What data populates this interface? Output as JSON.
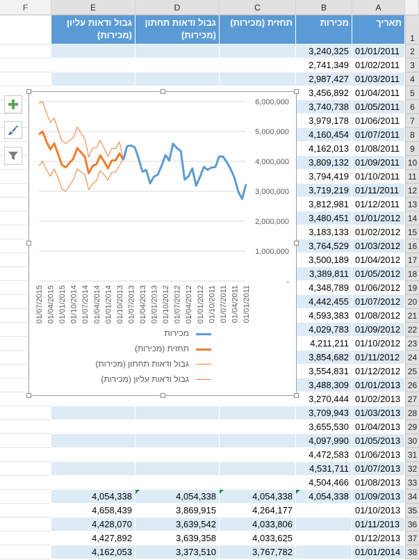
{
  "columns": [
    "F",
    "E",
    "D",
    "C",
    "B",
    "A"
  ],
  "header_row": {
    "A": "תאריך",
    "B": "מכירות",
    "C": "תחזית (מכירות)",
    "D": "גבול ודאות תחתון (מכירות)",
    "E": "גבול ודאות עליון (מכירות)"
  },
  "rows": [
    {
      "n": "1"
    },
    {
      "n": "2",
      "a": "01/01/2011",
      "b": "3,240,325"
    },
    {
      "n": "3",
      "a": "01/02/2011",
      "b": "2,741,349"
    },
    {
      "n": "4",
      "a": "01/03/2011",
      "b": "2,987,427"
    },
    {
      "n": "5",
      "a": "01/04/2011",
      "b": "3,456,892"
    },
    {
      "n": "6",
      "a": "01/05/2011",
      "b": "3,740,738"
    },
    {
      "n": "7",
      "a": "01/06/2011",
      "b": "3,979,178"
    },
    {
      "n": "8",
      "a": "01/07/2011",
      "b": "4,160,454"
    },
    {
      "n": "9",
      "a": "01/08/2011",
      "b": "4,162,013"
    },
    {
      "n": "10",
      "a": "01/09/2011",
      "b": "3,809,132"
    },
    {
      "n": "11",
      "a": "01/10/2011",
      "b": "3,794,419"
    },
    {
      "n": "12",
      "a": "01/11/2011",
      "b": "3,719,219"
    },
    {
      "n": "13",
      "a": "01/12/2011",
      "b": "3,812,981"
    },
    {
      "n": "14",
      "a": "01/01/2012",
      "b": "3,480,451"
    },
    {
      "n": "15",
      "a": "01/02/2012",
      "b": "3,183,133"
    },
    {
      "n": "16",
      "a": "01/03/2012",
      "b": "3,764,529"
    },
    {
      "n": "17",
      "a": "01/04/2012",
      "b": "3,500,189"
    },
    {
      "n": "18",
      "a": "01/05/2012",
      "b": "3,389,811"
    },
    {
      "n": "19",
      "a": "01/06/2012",
      "b": "4,348,789"
    },
    {
      "n": "20",
      "a": "01/07/2012",
      "b": "4,442,455"
    },
    {
      "n": "21",
      "a": "01/08/2012",
      "b": "4,593,383"
    },
    {
      "n": "22",
      "a": "01/09/2012",
      "b": "4,029,783"
    },
    {
      "n": "23",
      "a": "01/10/2012",
      "b": "4,211,211"
    },
    {
      "n": "24",
      "a": "01/11/2012",
      "b": "3,854,682"
    },
    {
      "n": "25",
      "a": "01/12/2012",
      "b": "3,554,831"
    },
    {
      "n": "26",
      "a": "01/01/2013",
      "b": "3,488,309"
    },
    {
      "n": "27",
      "a": "01/02/2013",
      "b": "3,270,444"
    },
    {
      "n": "28",
      "a": "01/03/2013",
      "b": "3,709,943"
    },
    {
      "n": "29",
      "a": "01/04/2013",
      "b": "3,655,530"
    },
    {
      "n": "30",
      "a": "01/05/2013",
      "b": "4,097,990"
    },
    {
      "n": "31",
      "a": "01/06/2013",
      "b": "4,472,583"
    },
    {
      "n": "32",
      "a": "01/07/2013",
      "b": "4,531,711"
    },
    {
      "n": "33",
      "a": "01/08/2013",
      "b": "4,504,466"
    },
    {
      "n": "34",
      "a": "01/09/2013",
      "b": "4,054,338",
      "c": "4,054,338",
      "d": "4,054,338",
      "e": "4,054,338"
    },
    {
      "n": "35",
      "a": "01/10/2013",
      "c": "4,264,177",
      "d": "3,869,915",
      "e": "4,658,439"
    },
    {
      "n": "36",
      "a": "01/11/2013",
      "c": "4,033,806",
      "d": "3,639,542",
      "e": "4,428,070"
    },
    {
      "n": "37",
      "a": "01/12/2013",
      "c": "4,033,625",
      "d": "3,639,358",
      "e": "4,427,892"
    },
    {
      "n": "38",
      "a": "01/01/2014",
      "c": "3,767,782",
      "d": "3,373,510",
      "e": "4,162,053"
    }
  ],
  "chart_data": {
    "type": "line",
    "x_direction": "right-to-left",
    "y_axis": {
      "position": "right",
      "ylim": [
        0,
        6000000
      ],
      "ticks": [
        {
          "v": 0,
          "label": "-"
        },
        {
          "v": 1000000,
          "label": "1,000,000"
        },
        {
          "v": 2000000,
          "label": "2,000,000"
        },
        {
          "v": 3000000,
          "label": "3,000,000"
        },
        {
          "v": 4000000,
          "label": "4,000,000"
        },
        {
          "v": 5000000,
          "label": "5,000,000"
        },
        {
          "v": 6000000,
          "label": "6,000,000"
        }
      ]
    },
    "x_tick_labels": [
      "01/01/2011",
      "01/04/2011",
      "01/07/2011",
      "01/10/2011",
      "01/01/2012",
      "01/04/2012",
      "01/07/2012",
      "01/10/2012",
      "01/01/2013",
      "01/04/2013",
      "01/07/2013",
      "01/10/2013",
      "01/01/2014",
      "01/04/2014",
      "01/07/2014",
      "01/10/2014",
      "01/01/2015",
      "01/04/2015",
      "01/07/2015"
    ],
    "x_count": 55,
    "grid": true,
    "legend_position": "bottom",
    "series": [
      {
        "name": "מכירות",
        "color": "#5b9bd5",
        "width": 3,
        "start": 0,
        "values": [
          3240325,
          2741349,
          2987427,
          3456892,
          3740738,
          3979178,
          4160454,
          4162013,
          3809132,
          3794419,
          3719219,
          3812981,
          3480451,
          3183133,
          3764529,
          3500189,
          3389811,
          4348789,
          4442455,
          4593383,
          4029783,
          4211211,
          3854682,
          3554831,
          3488309,
          3270444,
          3709943,
          3655530,
          4097990,
          4472583,
          4531711,
          4504466,
          4054338
        ]
      },
      {
        "name": "תחזית (מכירות)",
        "color": "#ed7d31",
        "width": 3,
        "start": 32,
        "values": [
          4054338,
          4264177,
          4033806,
          4033625,
          3767782,
          4000000,
          4200000,
          3900000,
          3850000,
          3600000,
          4150000,
          4300000,
          4450000,
          4100000,
          3950000,
          3800000,
          3880000,
          4250000,
          4600000,
          4400000,
          4650000,
          5000000,
          4900000
        ]
      },
      {
        "name": "גבול ודאות תחתון (מכירות)",
        "color": "#ed7d31",
        "width": 1,
        "start": 32,
        "values": [
          4054338,
          3869915,
          3639542,
          3639358,
          3373510,
          3550000,
          3700000,
          3350000,
          3250000,
          3050000,
          3550000,
          3650000,
          3750000,
          3400000,
          3200000,
          3000000,
          3080000,
          3450000,
          3750000,
          3500000,
          3700000,
          4000000,
          3850000
        ]
      },
      {
        "name": "גבול ודאות עליון (מכירות)",
        "color": "#ed7d31",
        "width": 1,
        "start": 32,
        "values": [
          4054338,
          4658439,
          4428070,
          4427892,
          4162053,
          4450000,
          4700000,
          4450000,
          4450000,
          4150000,
          4750000,
          4950000,
          5150000,
          4800000,
          4700000,
          4600000,
          4680000,
          5050000,
          5450000,
          5300000,
          5600000,
          6000000,
          5950000
        ]
      }
    ]
  },
  "side_buttons": [
    "plus-icon",
    "brush-icon",
    "filter-icon"
  ]
}
